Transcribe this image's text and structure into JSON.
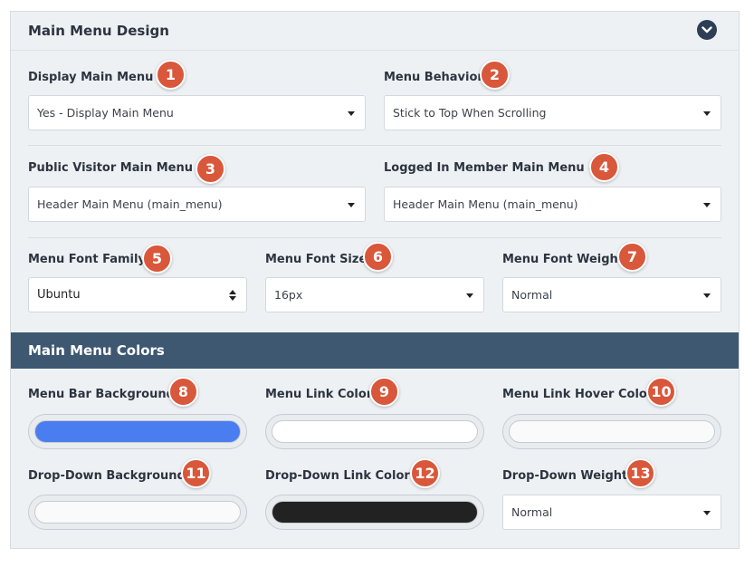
{
  "panel": {
    "title": "Main Menu Design"
  },
  "fields": {
    "display_main_menu": {
      "label": "Display Main Menu",
      "value": "Yes - Display Main Menu",
      "badge": "1"
    },
    "menu_behavior": {
      "label": "Menu Behavior",
      "value": "Stick to Top When Scrolling",
      "badge": "2"
    },
    "public_visitor_menu": {
      "label": "Public Visitor Main Menu",
      "value": "Header Main Menu (main_menu)",
      "badge": "3"
    },
    "logged_in_menu": {
      "label": "Logged In Member Main Menu",
      "value": "Header Main Menu (main_menu)",
      "badge": "4"
    },
    "menu_font_family": {
      "label": "Menu Font Family",
      "value": "Ubuntu",
      "badge": "5"
    },
    "menu_font_size": {
      "label": "Menu Font Size",
      "value": "16px",
      "badge": "6"
    },
    "menu_font_weight": {
      "label": "Menu Font Weight",
      "value": "Normal",
      "badge": "7"
    }
  },
  "colors": {
    "title": "Main Menu Colors",
    "menu_bar_background": {
      "label": "Menu Bar Background",
      "badge": "8",
      "color": "#4a7ef0"
    },
    "menu_link_color": {
      "label": "Menu Link Color",
      "badge": "9",
      "color": "#ffffff"
    },
    "menu_link_hover_color": {
      "label": "Menu Link Hover Color",
      "badge": "10",
      "color": "#fafafa"
    },
    "dropdown_background": {
      "label": "Drop-Down Background",
      "badge": "11",
      "color": "#fafafa"
    },
    "dropdown_link_color": {
      "label": "Drop-Down Link Color",
      "badge": "12",
      "color": "#222222"
    },
    "dropdown_weight": {
      "label": "Drop-Down Weight",
      "badge": "13",
      "value": "Normal"
    }
  },
  "icons": {
    "collapse": "chevron-down-icon",
    "help": "question-circle-icon",
    "dropdown": "caret-down-icon",
    "select": "up-down-arrows-icon"
  },
  "theme": {
    "badge_color": "#d9573a",
    "colors_header_bg": "#3e5872",
    "panel_bg": "#eef1f4"
  }
}
